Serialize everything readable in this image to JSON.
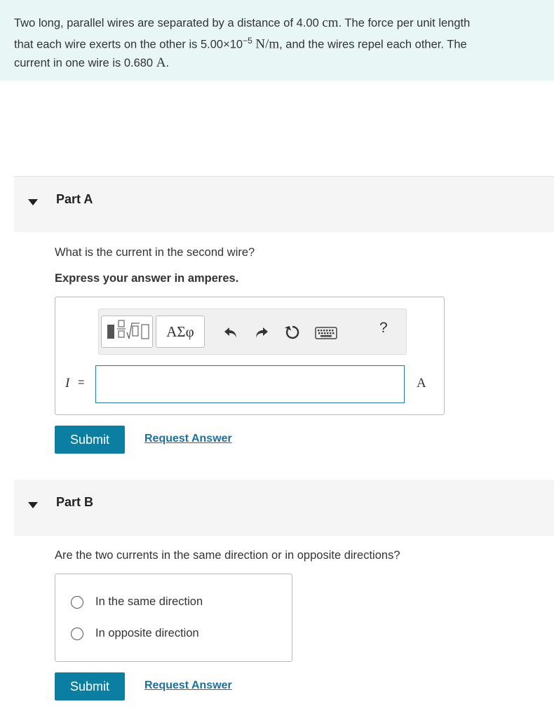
{
  "problem": {
    "line1_a": "Two long, parallel wires are separated by a distance of 4.00 ",
    "line1_unit": "cm",
    "line1_b": ". The force per unit length",
    "line2_a": "that each wire exerts on the other is 5.00×10",
    "line2_exp": "−5",
    "line2_unit": "N/m",
    "line2_b": ", and the wires repel each other. The",
    "line3_a": "current in one wire is 0.680 ",
    "line3_unit": "A",
    "line3_b": "."
  },
  "part_a": {
    "title": "Part A",
    "question": "What is the current in the second wire?",
    "instruction": "Express your answer in amperes.",
    "toolbar": {
      "greek_label": "ΑΣφ",
      "help_label": "?",
      "icons": [
        "templates-icon",
        "undo-icon",
        "redo-icon",
        "reset-icon",
        "keyboard-icon",
        "help-icon"
      ]
    },
    "variable": "I",
    "equals": "=",
    "input_value": "",
    "unit": "A",
    "submit_label": "Submit",
    "request_label": "Request Answer"
  },
  "part_b": {
    "title": "Part B",
    "question": "Are the two currents in the same direction or in opposite directions?",
    "options": [
      "In the same direction",
      "In opposite direction"
    ],
    "submit_label": "Submit",
    "request_label": "Request Answer"
  },
  "colors": {
    "problem_bg": "#e8f6f6",
    "part_header_bg": "#f5f5f5",
    "submit_bg": "#0c7ea1",
    "link": "#1e6fa0",
    "input_border": "#2a7aa7"
  }
}
